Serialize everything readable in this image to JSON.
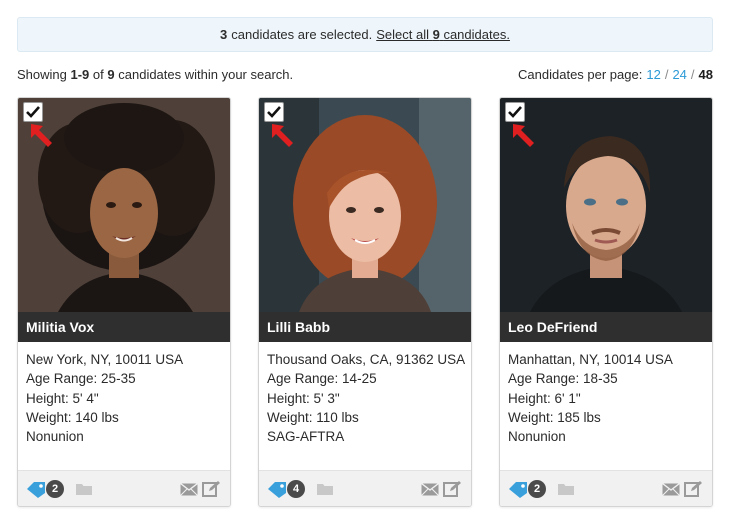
{
  "banner": {
    "count": "3",
    "text": "candidates are selected.",
    "link_prefix": "Select all",
    "link_count": "9",
    "link_suffix": "candidates."
  },
  "results": {
    "prefix": "Showing",
    "range": "1-9",
    "of": "of",
    "total": "9",
    "suffix": "candidates within your search."
  },
  "per_page": {
    "label": "Candidates per page:",
    "options": [
      "12",
      "24",
      "48"
    ],
    "selected": "48",
    "separator": "/"
  },
  "colors": {
    "accent_blue": "#2d9ad6",
    "name_bar": "#2f2f2f",
    "arrow_red": "#e02020",
    "tag_icon": "#3aa0dc"
  },
  "icons": [
    "checkbox-icon",
    "arrow-icon",
    "tag-icon",
    "folder-icon",
    "mail-icon",
    "edit-icon"
  ],
  "candidates": [
    {
      "name": "Militia Vox",
      "location": "New York, NY, 10011 USA",
      "age_range": "Age Range: 25-35",
      "height": "Height: 5' 4\"",
      "weight": "Weight: 140 lbs",
      "union": "Nonunion",
      "tag_count": "2",
      "selected": true
    },
    {
      "name": "Lilli Babb",
      "location": "Thousand Oaks, CA, 91362 USA",
      "age_range": "Age Range: 14-25",
      "height": "Height: 5' 3\"",
      "weight": "Weight: 110 lbs",
      "union": "SAG-AFTRA",
      "tag_count": "4",
      "selected": true
    },
    {
      "name": "Leo DeFriend",
      "location": "Manhattan, NY, 10014 USA",
      "age_range": "Age Range: 18-35",
      "height": "Height: 6' 1\"",
      "weight": "Weight: 185 lbs",
      "union": "Nonunion",
      "tag_count": "2",
      "selected": true
    }
  ]
}
